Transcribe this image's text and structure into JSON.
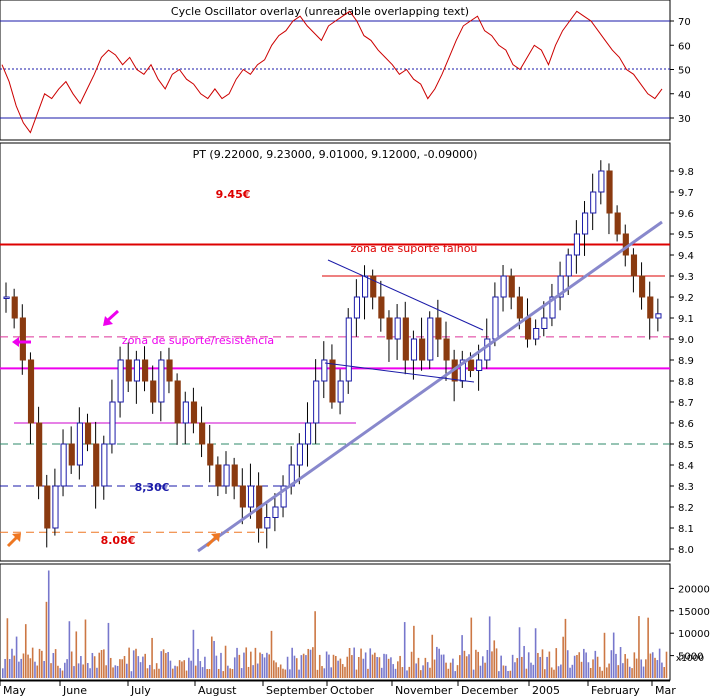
{
  "chart_data": [
    {
      "panel": "oscillator",
      "type": "line",
      "title": "Cycle Oscillator overlay (unreadable overlapping text)",
      "y_ticks": [
        30,
        40,
        50,
        60,
        70
      ],
      "ylim": [
        22,
        75
      ],
      "reference_lines": [
        {
          "y": 70,
          "style": "solid",
          "color": "#1a1aa8"
        },
        {
          "y": 50,
          "style": "dotted",
          "color": "#1a1aa8"
        },
        {
          "y": 30,
          "style": "solid",
          "color": "#1a1aa8"
        }
      ],
      "series": [
        {
          "color": "#cc0000",
          "values": [
            52,
            45,
            35,
            28,
            24,
            32,
            40,
            38,
            42,
            45,
            40,
            36,
            42,
            48,
            55,
            58,
            56,
            52,
            55,
            50,
            48,
            52,
            46,
            42,
            48,
            50,
            46,
            44,
            40,
            38,
            42,
            38,
            40,
            46,
            50,
            48,
            52,
            54,
            60,
            64,
            66,
            70,
            72,
            68,
            65,
            62,
            68,
            70,
            72,
            74,
            70,
            64,
            62,
            58,
            55,
            52,
            48,
            50,
            46,
            44,
            38,
            42,
            48,
            55,
            62,
            68,
            70,
            72,
            66,
            64,
            60,
            58,
            52,
            50,
            55,
            60,
            58,
            52,
            60,
            66,
            70,
            74,
            72,
            70,
            66,
            62,
            58,
            55,
            50,
            48,
            44,
            40,
            38,
            42
          ]
        }
      ]
    },
    {
      "panel": "price",
      "type": "candlestick",
      "title": "PT (9.22000, 9.23000, 9.01000, 9.12000, -0.09000)",
      "x_months": [
        "May",
        "June",
        "July",
        "August",
        "September",
        "October",
        "November",
        "December",
        "2005",
        "February",
        "Mar"
      ],
      "y_ticks": [
        "8.0",
        "8.1",
        "8.2",
        "8.3",
        "8.4",
        "8.5",
        "8.6",
        "8.7",
        "8.8",
        "8.9",
        "9.0",
        "9.1",
        "9.2",
        "9.3",
        "9.4",
        "9.5",
        "9.6",
        "9.7",
        "9.8"
      ],
      "ylim": [
        7.95,
        9.85
      ],
      "closes": [
        9.2,
        9.1,
        8.9,
        8.6,
        8.3,
        8.1,
        8.3,
        8.5,
        8.4,
        8.6,
        8.5,
        8.3,
        8.5,
        8.7,
        8.9,
        8.8,
        8.9,
        8.8,
        8.7,
        8.9,
        8.8,
        8.6,
        8.7,
        8.6,
        8.5,
        8.4,
        8.3,
        8.4,
        8.3,
        8.2,
        8.3,
        8.1,
        8.15,
        8.2,
        8.3,
        8.4,
        8.5,
        8.6,
        8.8,
        8.9,
        8.7,
        8.8,
        9.1,
        9.2,
        9.3,
        9.2,
        9.1,
        9.0,
        9.1,
        8.9,
        9.0,
        8.9,
        9.1,
        9.0,
        8.9,
        8.8,
        8.9,
        8.85,
        8.9,
        9.0,
        9.2,
        9.3,
        9.2,
        9.1,
        9.0,
        9.05,
        9.1,
        9.2,
        9.3,
        9.4,
        9.5,
        9.6,
        9.7,
        9.8,
        9.6,
        9.5,
        9.4,
        9.3,
        9.2,
        9.1,
        9.12
      ],
      "horizontal_levels": [
        {
          "y": 9.45,
          "color": "#dd0000",
          "style": "solid"
        },
        {
          "y": 9.3,
          "color": "#dd0000",
          "style": "solid"
        },
        {
          "y": 9.01,
          "color": "#dd3399",
          "style": "dashed"
        },
        {
          "y": 8.86,
          "color": "#ee00ee",
          "style": "solid"
        },
        {
          "y": 8.6,
          "color": "#cc00cc",
          "style": "solid"
        },
        {
          "y": 8.5,
          "color": "#2d8a6a",
          "style": "dashed"
        },
        {
          "y": 8.3,
          "color": "#1a1aa8",
          "style": "dashed"
        },
        {
          "y": 8.08,
          "color": "#ee7722",
          "style": "dashed"
        }
      ],
      "annotations": [
        {
          "text": "9.45€",
          "color": "#dd0000"
        },
        {
          "text": "zona de suporte falhou",
          "color": "#dd0000"
        },
        {
          "text": "zona de suporte/resistência",
          "color": "#ee00ee"
        },
        {
          "text": "8,30€",
          "color": "#1a1aa8"
        },
        {
          "text": "8.08€",
          "color": "#dd0000"
        }
      ]
    },
    {
      "panel": "volume",
      "type": "bar",
      "y_ticks": [
        "5000",
        "10000",
        "15000",
        "20000"
      ],
      "y_unit": "x1000",
      "ylim": [
        0,
        25000
      ],
      "colors": {
        "up": "#7777cc",
        "down": "#cc7744"
      }
    }
  ]
}
